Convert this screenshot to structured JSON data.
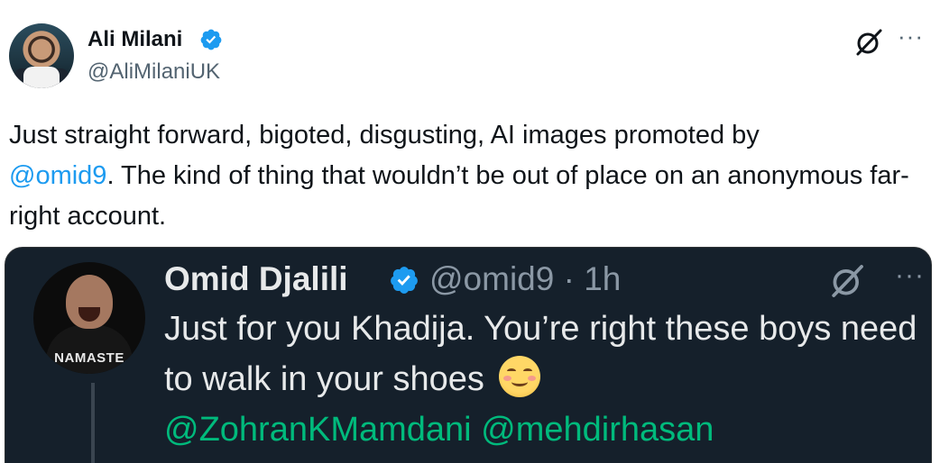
{
  "author": {
    "name": "Ali Milani",
    "handle": "@AliMilaniUK"
  },
  "tweet": {
    "text_part1": "Just straight forward, bigoted, disgusting, AI images promoted by",
    "mention": "@omid9",
    "text_part2": ". The kind of thing that wouldn’t be out of place on an anonymous far-right account."
  },
  "embedded_tweet": {
    "name": "Omid Djalili",
    "handle_time": "@omid9 · 1h",
    "avatar_shirt_text": "NAMASTE",
    "text": "Just for you Khadija. You’re right these boys need to walk in your shoes",
    "emoji": "smiling-face-emoji",
    "mention1": "@ZohranKMamdani",
    "mention2": "@mehdirhasan"
  },
  "icons": {
    "verified": "verified-badge-icon",
    "grok": "grok-icon",
    "more": "more-icon"
  },
  "colors": {
    "accent_blue": "#1d9bf0",
    "embed_mention_green": "#00ba7c",
    "embed_bg": "#15202b",
    "text_secondary": "#536471"
  },
  "more_glyph": "···"
}
